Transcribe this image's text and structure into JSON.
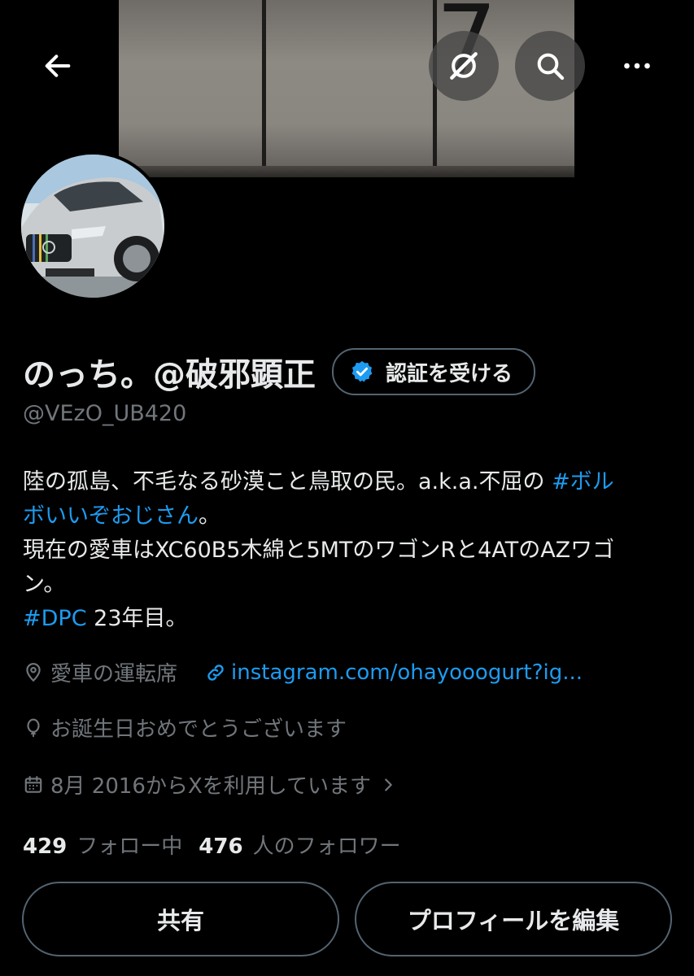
{
  "banner": {
    "door_number": "7"
  },
  "header_buttons": {
    "back_icon": "arrow-left-icon",
    "grok_icon": "grok-slash-icon",
    "search_icon": "search-icon",
    "more_icon": "more-horizontal-icon"
  },
  "profile": {
    "display_name": "のっち。@破邪顕正",
    "verify_label": "認証を受ける",
    "handle": "@VEzO_UB420",
    "bio": {
      "line1_text": "陸の孤島、不毛なる砂漠こと鳥取の民。a.k.a.不屈の ",
      "line1_tag": "#ボル",
      "line2_tag": "ボいいぞおじさん",
      "line2_text": "。",
      "line3": "現在の愛車はXC60B5木綿と5MTのワゴンRと4ATのAZワゴ",
      "line4": "ン。",
      "line5_tag": "#DPC",
      "line5_text": " 23年目。"
    },
    "location": "愛車の運転席",
    "link": "instagram.com/ohayooogurt?ig...",
    "birthday": "お誕生日おめでとうございます",
    "joined": "8月 2016からXを利用しています",
    "following_count": "429",
    "following_label": "フォロー中",
    "followers_count": "476",
    "followers_label": "人のフォロワー"
  },
  "actions": {
    "share_label": "共有",
    "edit_label": "プロフィールを編集"
  },
  "colors": {
    "accent": "#1d9bf0",
    "text": "#e7e9ea",
    "muted": "#71767b",
    "border": "#536471",
    "background": "#000000"
  }
}
